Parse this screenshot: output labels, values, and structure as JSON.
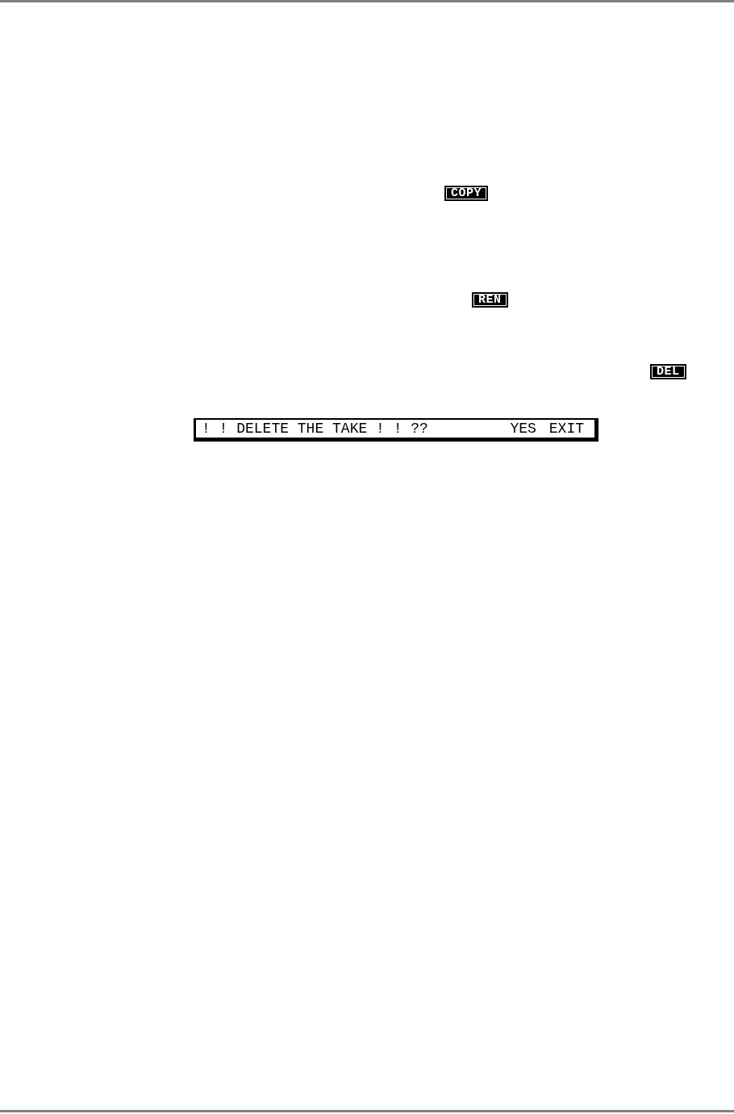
{
  "keys": [
    {
      "label": "COPY"
    },
    {
      "label": "REN"
    },
    {
      "label": "DEL"
    }
  ],
  "dialog": {
    "message": "! ! DELETE THE TAKE ! ! ??",
    "options": [
      "YES",
      "EXIT"
    ]
  }
}
